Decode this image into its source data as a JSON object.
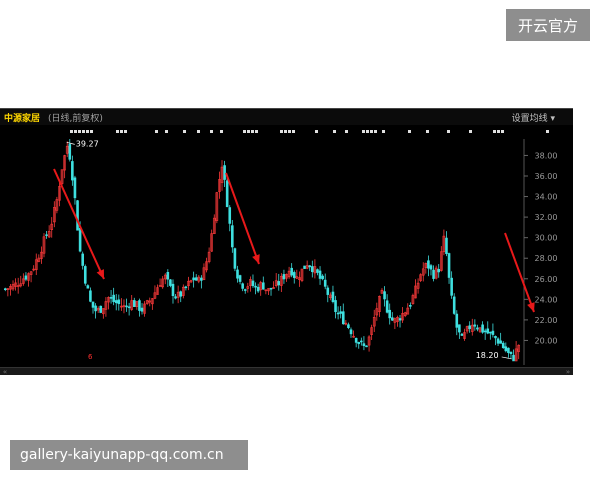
{
  "top_badge": "开云官方",
  "watermark": "gallery-kaiyunapp-qq.com.cn",
  "window": {
    "stock_name": "中源家居",
    "period": "(日线,前复权)",
    "settings": "设置均线 ▾",
    "marker_red": "6",
    "scroll_left": "«",
    "scroll_right": "»"
  },
  "colors": {
    "background": "#000000",
    "up": "#ff3b3b",
    "down": "#3fe0e0",
    "axis": "#9a9a9a",
    "arrow": "#e8191a"
  },
  "chart_data": {
    "type": "candlestick",
    "y_ticks": [
      "20.00",
      "22.00",
      "24.00",
      "26.00",
      "28.00",
      "30.00",
      "32.00",
      "34.00",
      "36.00",
      "38.00"
    ],
    "ylim": [
      18.0,
      39.6
    ],
    "annotations": [
      {
        "text": "39.27",
        "kind": "high"
      },
      {
        "text": "18.20",
        "kind": "low"
      }
    ],
    "close_path": [
      25.0,
      25.2,
      25.5,
      26.0,
      26.4,
      27.2,
      28.5,
      30.0,
      31.2,
      33.5,
      37.0,
      39.27,
      35.0,
      29.0,
      26.0,
      23.5,
      22.8,
      23.2,
      24.2,
      23.8,
      23.5,
      23.2,
      23.8,
      23.4,
      23.0,
      23.6,
      24.4,
      25.6,
      26.2,
      25.0,
      24.2,
      24.6,
      25.4,
      26.0,
      25.8,
      27.0,
      29.5,
      34.0,
      37.2,
      33.0,
      28.0,
      25.8,
      25.2,
      25.6,
      25.0,
      25.5,
      24.8,
      25.2,
      25.6,
      26.4,
      27.0,
      26.0,
      26.8,
      27.6,
      27.0,
      26.2,
      25.2,
      24.0,
      22.8,
      22.2,
      21.5,
      20.6,
      19.8,
      19.3,
      20.5,
      23.0,
      24.5,
      23.0,
      21.8,
      22.2,
      22.8,
      23.6,
      25.0,
      26.8,
      27.4,
      26.4,
      27.0,
      30.2,
      24.8,
      21.5,
      20.0,
      21.0,
      21.8,
      21.2,
      20.9,
      20.6,
      20.2,
      19.6,
      18.8,
      18.2,
      19.6
    ]
  }
}
